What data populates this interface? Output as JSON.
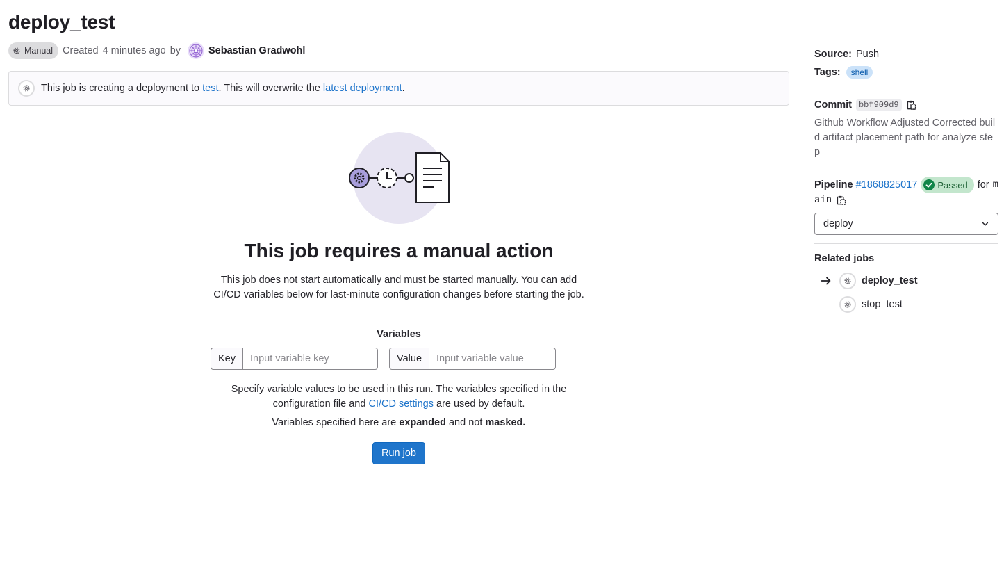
{
  "job": {
    "title": "deploy_test",
    "status_badge": "Manual",
    "created_prefix": "Created",
    "created_time": "4 minutes ago",
    "by": "by",
    "author": "Sebastian Gradwohl"
  },
  "alert": {
    "text1": "This job is creating a deployment to",
    "env_link": "test",
    "text2": ". This will overwrite the",
    "latest_link": "latest deployment",
    "text3": "."
  },
  "empty_state": {
    "title": "This job requires a manual action",
    "description": "This job does not start automatically and must be started manually. You can add CI/CD variables below for last-minute configuration changes before starting the job.",
    "variables_label": "Variables",
    "key_label": "Key",
    "key_placeholder": "Input variable key",
    "value_label": "Value",
    "value_placeholder": "Input variable value",
    "help_text1": "Specify variable values to be used in this run. The variables specified in the configuration file and",
    "help_link": "CI/CD settings",
    "help_text2": "are used by default.",
    "note_prefix": "Variables specified here are",
    "note_expanded": "expanded",
    "note_middle": "and not",
    "note_masked": "masked.",
    "run_button": "Run job"
  },
  "sidebar": {
    "source_label": "Source:",
    "source_value": "Push",
    "tags_label": "Tags:",
    "tag": "shell",
    "commit_label": "Commit",
    "commit_sha": "bbf909d9",
    "commit_message": "Github Workflow Adjusted Corrected build artifact placement path for analyze step",
    "pipeline_label": "Pipeline",
    "pipeline_id": "#1868825017",
    "pipeline_status": "Passed",
    "for": "for",
    "branch_part1": "m",
    "branch_part2": "ain",
    "stage_select": "deploy",
    "related_jobs_label": "Related jobs",
    "related_jobs": [
      "deploy_test",
      "stop_test"
    ]
  },
  "colors": {
    "link": "#1f75cb",
    "primary_button": "#1f75cb",
    "passed_bg": "#c3e6cd",
    "passed_icon": "#108548",
    "illustration_circle": "#e7e4f2",
    "illustration_accent": "#a89edc"
  }
}
